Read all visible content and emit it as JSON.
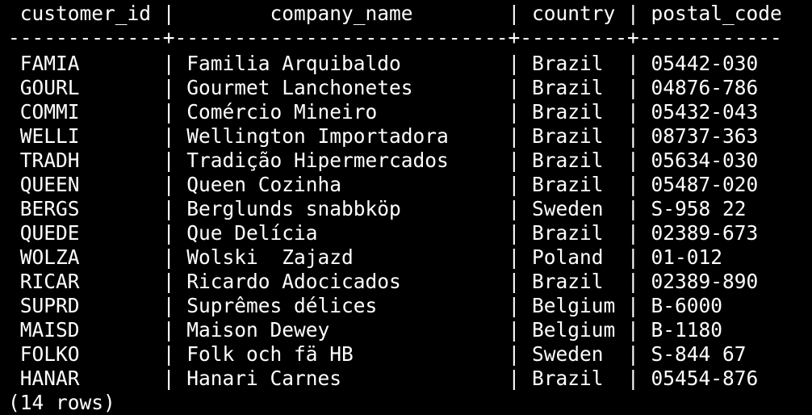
{
  "terminal": {
    "header": " customer_id |        company_name        | country | postal_code",
    "separator": "-------------+----------------------------+---------+------------",
    "rows": [
      " FAMIA       | Familia Arquibaldo         | Brazil  | 05442-030",
      " GOURL       | Gourmet Lanchonetes        | Brazil  | 04876-786",
      " COMMI       | Comércio Mineiro           | Brazil  | 05432-043",
      " WELLI       | Wellington Importadora     | Brazil  | 08737-363",
      " TRADH       | Tradição Hipermercados     | Brazil  | 05634-030",
      " QUEEN       | Queen Cozinha              | Brazil  | 05487-020",
      " BERGS       | Berglunds snabbköp         | Sweden  | S-958 22",
      " QUEDE       | Que Delícia                | Brazil  | 02389-673",
      " WOLZA       | Wolski  Zajazd             | Poland  | 01-012",
      " RICAR       | Ricardo Adocicados         | Brazil  | 02389-890",
      " SUPRD       | Suprêmes délices           | Belgium | B-6000",
      " MAISD       | Maison Dewey               | Belgium | B-1180",
      " FOLKO       | Folk och fä HB             | Sweden  | S-844 67",
      " HANAR       | Hanari Carnes              | Brazil  | 05454-876"
    ],
    "footer": "(14 rows)"
  },
  "colors": {
    "background": "#000000",
    "text": "#ffffff"
  }
}
